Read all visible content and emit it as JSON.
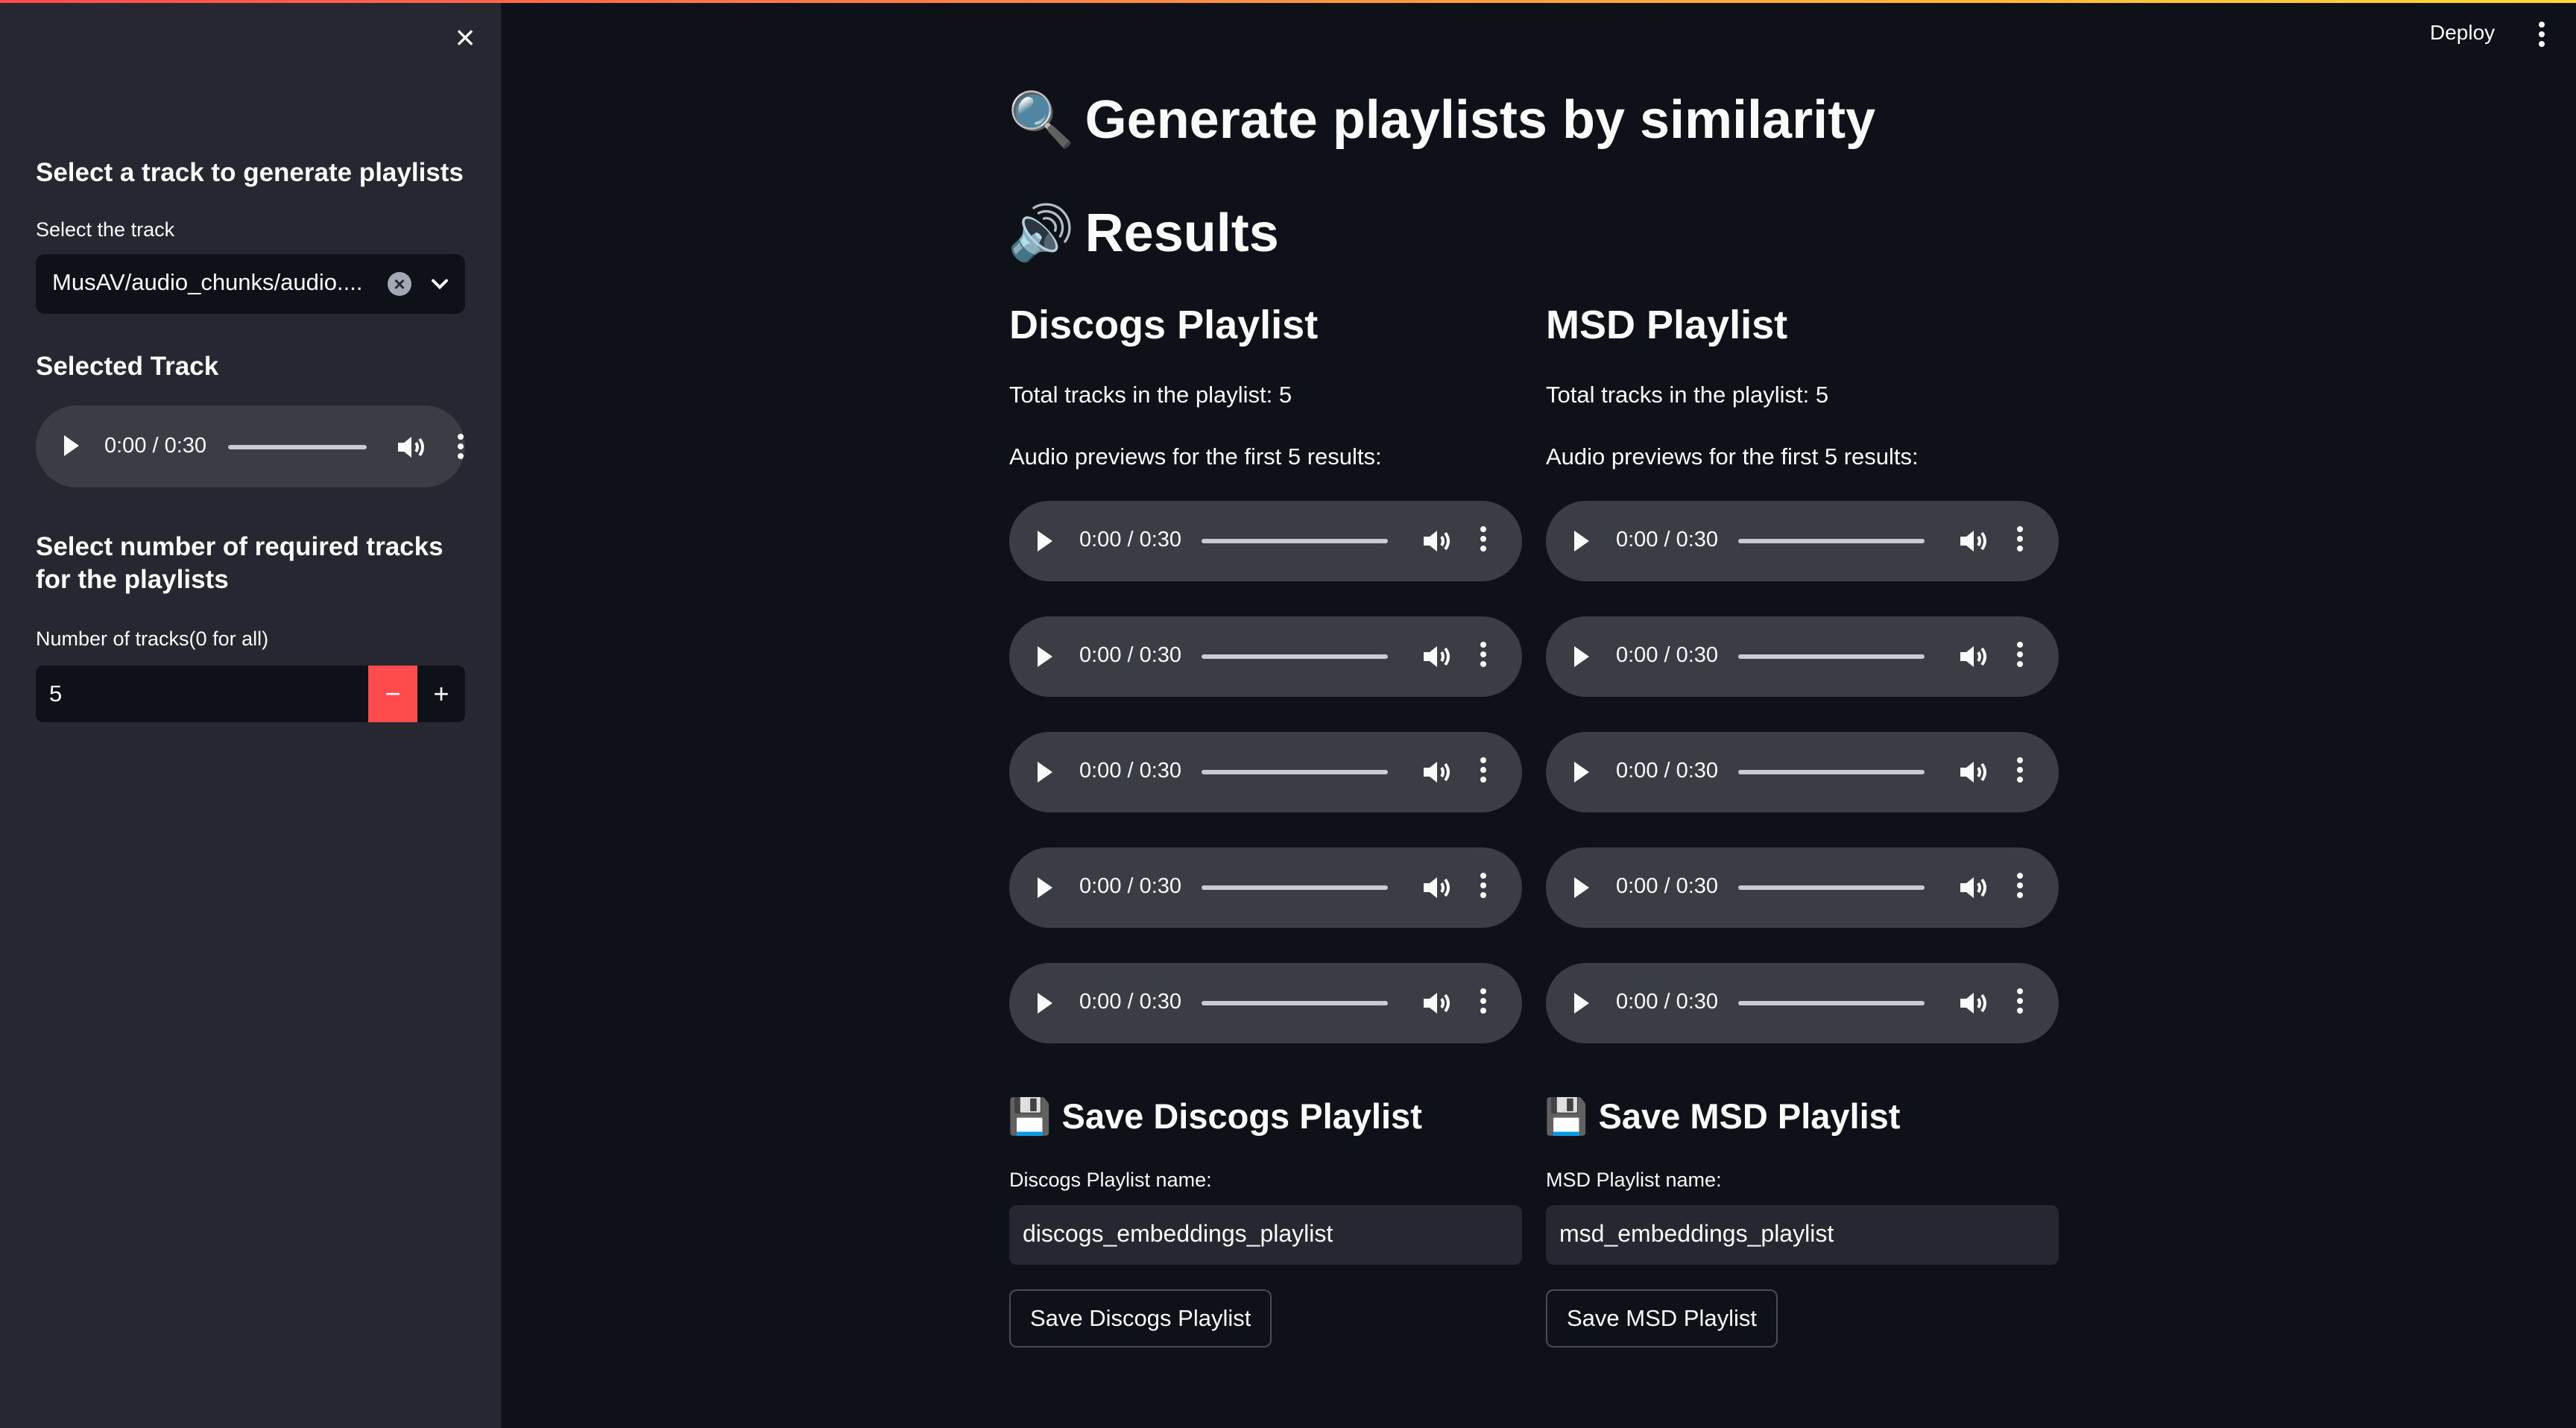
{
  "sidebar": {
    "close_label": "×",
    "heading_select": "Select a track to generate playlists",
    "track_label": "Select the track",
    "track_value": "MusAV/audio_chunks/audio....",
    "selected_heading": "Selected Track",
    "selected_audio_time": "0:00 / 0:30",
    "tracks_heading": "Select number of required tracks for the playlists",
    "number_label": "Number of tracks(0 for all)",
    "number_value": "5",
    "minus_label": "−",
    "plus_label": "+"
  },
  "header": {
    "deploy_label": "Deploy"
  },
  "main": {
    "title_emoji": "🔍",
    "title": "Generate playlists by similarity",
    "results_emoji": "🔊",
    "results": "Results",
    "discogs": {
      "heading": "Discogs Playlist",
      "total": "Total tracks in the playlist: 5",
      "previews": "Audio previews for the first 5 results:",
      "audio_times": [
        "0:00 / 0:30",
        "0:00 / 0:30",
        "0:00 / 0:30",
        "0:00 / 0:30",
        "0:00 / 0:30"
      ],
      "save_emoji": "💾",
      "save_heading": "Save Discogs Playlist",
      "name_label": "Discogs Playlist name:",
      "name_value": "discogs_embeddings_playlist",
      "save_button": "Save Discogs Playlist"
    },
    "msd": {
      "heading": "MSD Playlist",
      "total": "Total tracks in the playlist: 5",
      "previews": "Audio previews for the first 5 results:",
      "audio_times": [
        "0:00 / 0:30",
        "0:00 / 0:30",
        "0:00 / 0:30",
        "0:00 / 0:30",
        "0:00 / 0:30"
      ],
      "save_emoji": "💾",
      "save_heading": "Save MSD Playlist",
      "name_label": "MSD Playlist name:",
      "name_value": "msd_embeddings_playlist",
      "save_button": "Save MSD Playlist"
    }
  },
  "colors": {
    "background": "#0e1117",
    "sidebar": "#262730",
    "player": "#3b3d45",
    "accent": "#ff4b4b"
  }
}
